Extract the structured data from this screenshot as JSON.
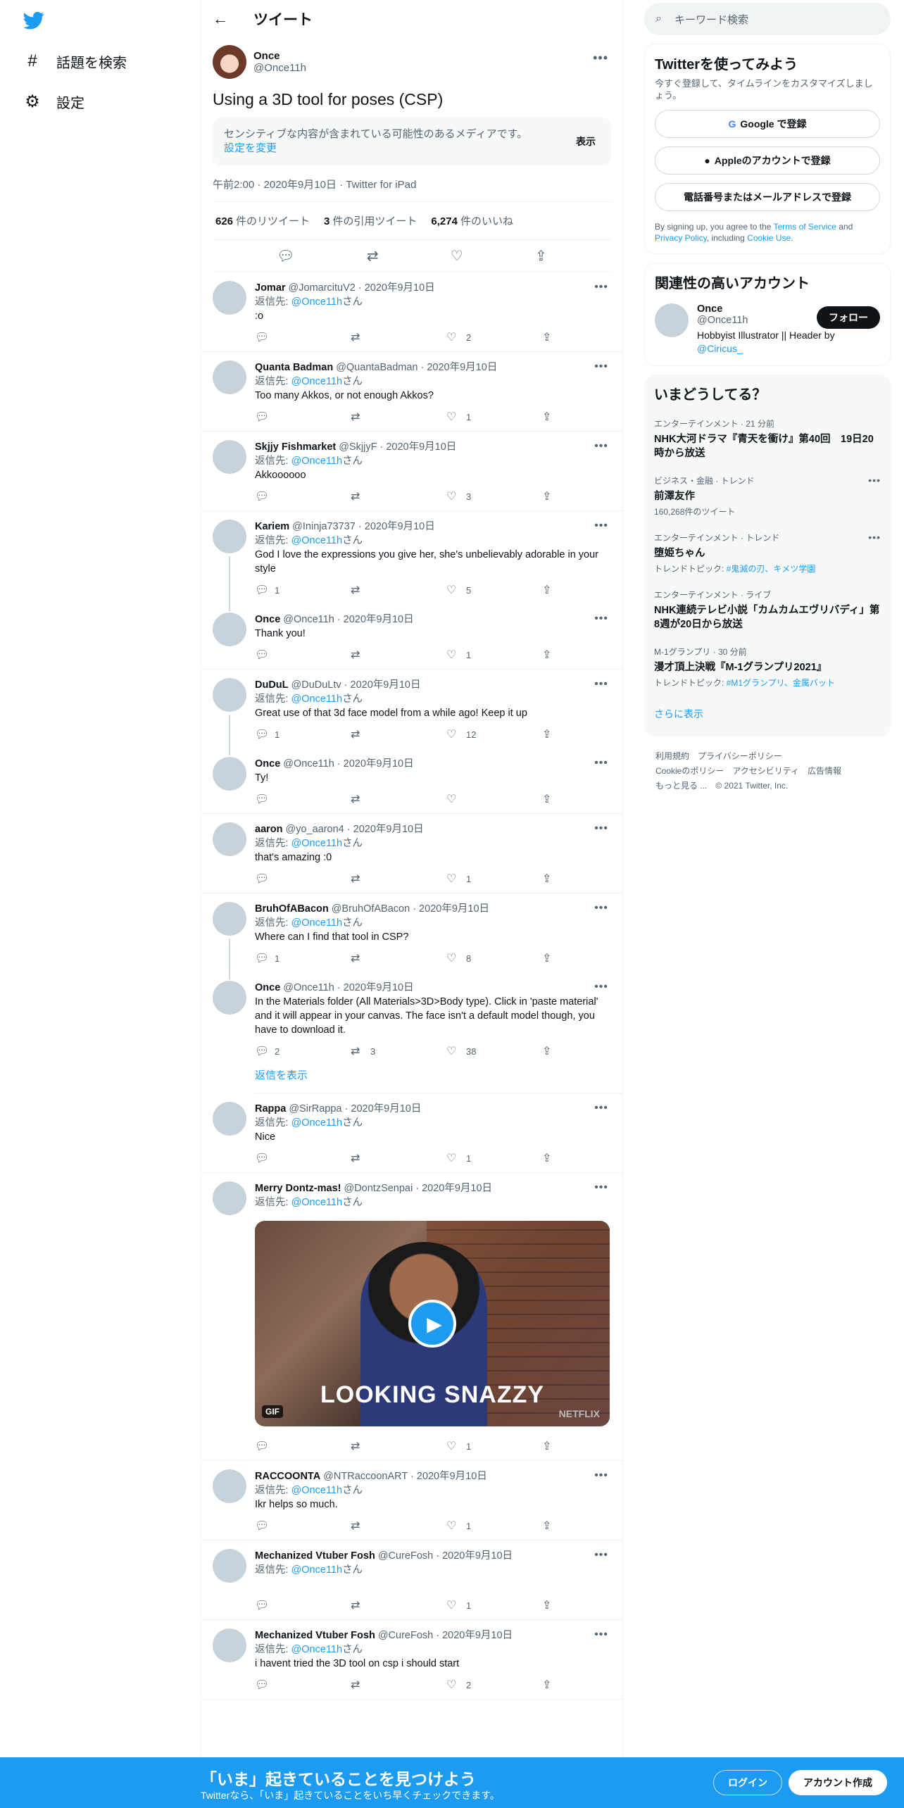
{
  "nav": {
    "explore_label": "話題を検索",
    "settings_label": "設定"
  },
  "header": {
    "title": "ツイート"
  },
  "focal": {
    "name": "Once",
    "handle": "@Once11h",
    "text": "Using a 3D tool for poses (CSP)",
    "sensitive_msg": "センシティブな内容が含まれている可能性のあるメディアです。",
    "sensitive_link": "設定を変更",
    "show_label": "表示",
    "meta": "午前2:00 · 2020年9月10日 · Twitter for iPad",
    "retweets": "626",
    "retweets_label": "件のリツイート",
    "quotes": "3",
    "quotes_label": "件の引用ツイート",
    "likes": "6,274",
    "likes_label": "件のいいね"
  },
  "replies": [
    {
      "name": "Jomar",
      "handle": "@JomarcituV2 · 2020年9月10日",
      "to": "返信先: ",
      "to_link": "@Once11h",
      "to_suffix": "さん",
      "text": ":o",
      "replies": "",
      "rts": "",
      "likes": "2"
    },
    {
      "name": "Quanta Badman",
      "handle": "@QuantaBadman · 2020年9月10日",
      "to": "返信先: ",
      "to_link": "@Once11h",
      "to_suffix": "さん",
      "text": "Too many Akkos, or not enough Akkos?",
      "replies": "",
      "rts": "",
      "likes": "1"
    },
    {
      "name": "Skjjy Fishmarket",
      "handle": "@SkjjyF · 2020年9月10日",
      "to": "返信先: ",
      "to_link": "@Once11h",
      "to_suffix": "さん",
      "text": "Akkoooooo",
      "replies": "",
      "rts": "",
      "likes": "3"
    },
    {
      "name": "Kariem",
      "handle": "@Ininja73737 · 2020年9月10日",
      "to": "返信先: ",
      "to_link": "@Once11h",
      "to_suffix": "さん",
      "text": "God I love the expressions you give her, she's unbelievably  adorable in your style",
      "replies": "1",
      "rts": "",
      "likes": "5"
    },
    {
      "name": "Once",
      "handle": "@Once11h · 2020年9月10日",
      "text": "Thank you!",
      "replies": "",
      "rts": "",
      "likes": "1"
    },
    {
      "name": "DuDuL",
      "handle": "@DuDuLtv · 2020年9月10日",
      "to": "返信先: ",
      "to_link": "@Once11h",
      "to_suffix": "さん",
      "text": "Great use of that 3d face model from a while ago! Keep it up",
      "replies": "1",
      "rts": "",
      "likes": "12"
    },
    {
      "name": "Once",
      "handle": "@Once11h · 2020年9月10日",
      "text": "Ty!",
      "replies": "",
      "rts": "",
      "likes": ""
    },
    {
      "name": "aaron",
      "handle": "@yo_aaron4 · 2020年9月10日",
      "to": "返信先: ",
      "to_link": "@Once11h",
      "to_suffix": "さん",
      "text": "that's amazing :0",
      "replies": "",
      "rts": "",
      "likes": "1"
    },
    {
      "name": "BruhOfABacon",
      "handle": "@BruhOfABacon · 2020年9月10日",
      "to": "返信先: ",
      "to_link": "@Once11h",
      "to_suffix": "さん",
      "text": "Where can I find that tool in CSP?",
      "replies": "1",
      "rts": "",
      "likes": "8"
    },
    {
      "name": "Once",
      "handle": "@Once11h · 2020年9月10日",
      "text": "In the Materials folder (All Materials>3D>Body type). Click in 'paste material' and it will appear in your canvas. The face isn't a default model though, you have to download it.",
      "replies": "2",
      "rts": "3",
      "likes": "38"
    },
    {
      "name": "Rappa",
      "handle": "@SirRappa · 2020年9月10日",
      "to": "返信先: ",
      "to_link": "@Once11h",
      "to_suffix": "さん",
      "text": "Nice",
      "replies": "",
      "rts": "",
      "likes": "1"
    },
    {
      "name": "Merry Dontz-mas!",
      "handle": "@DontzSenpai · 2020年9月10日",
      "to": "返信先: ",
      "to_link": "@Once11h",
      "to_suffix": "さん",
      "text": "",
      "gif_caption": "LOOKING SNAZZY",
      "gif_badge": "GIF",
      "gif_brand": "NETFLIX",
      "replies": "",
      "rts": "",
      "likes": "1"
    },
    {
      "name": "RACCOONTA",
      "handle": "@NTRaccoonART · 2020年9月10日",
      "to": "返信先: ",
      "to_link": "@Once11h",
      "to_suffix": "さん",
      "text": "Ikr helps so much.",
      "replies": "",
      "rts": "",
      "likes": "1"
    },
    {
      "name": "Mechanized Vtuber Fosh",
      "handle": "@CureFosh · 2020年9月10日",
      "to": "返信先: ",
      "to_link": "@Once11h",
      "to_suffix": "さん",
      "text": "",
      "replies": "",
      "rts": "",
      "likes": "1"
    },
    {
      "name": "Mechanized Vtuber Fosh",
      "handle": "@CureFosh · 2020年9月10日",
      "to": "返信先: ",
      "to_link": "@Once11h",
      "to_suffix": "さん",
      "text": "i havent tried the 3D tool on csp i should start",
      "replies": "",
      "rts": "",
      "likes": "2"
    }
  ],
  "show_replies_label": "返信を表示",
  "sidebar": {
    "search_placeholder": "キーワード検索",
    "signup_title": "Twitterを使ってみよう",
    "signup_sub": "今すぐ登録して、タイムラインをカスタマイズしましょう。",
    "google_btn": "Google で登録",
    "apple_btn": "Appleのアカウントで登録",
    "phone_btn": "電話番号またはメールアドレスで登録",
    "terms_pre": "By signing up, you agree to the ",
    "terms_tos": "Terms of Service",
    "terms_and": " and ",
    "terms_privacy": "Privacy Policy",
    "terms_incl": ", including ",
    "terms_cookie": "Cookie Use",
    "terms_end": ".",
    "related_title": "関連性の高いアカウント",
    "acc_name": "Once",
    "acc_handle": "@Once11h",
    "follow_label": "フォロー",
    "acc_bio": "Hobbyist Illustrator || Header by ",
    "acc_bio_link": "@Ciricus_",
    "trends_title": "いまどうしてる？",
    "trends": [
      {
        "cat": "エンターテインメント · 21 分前",
        "ttl": "NHK大河ドラマ『青天を衝け』第40回　19日20時から放送",
        "sub": ""
      },
      {
        "cat": "ビジネス・金融 · トレンド",
        "ttl": "前澤友作",
        "sub": "160,268件のツイート"
      },
      {
        "cat": "エンターテインメント · トレンド",
        "ttl": "堕姫ちゃん",
        "sub": "トレンドトピック: ",
        "sub_link": "#鬼滅の刃、キメツ学園"
      },
      {
        "cat": "エンターテインメント · ライブ",
        "ttl": "NHK連続テレビ小説「カムカムエヴリバディ」第8週が20日から放送",
        "sub": ""
      },
      {
        "cat": "M-1グランプリ · 30 分前",
        "ttl": "漫才頂上決戦『M-1グランプリ2021』",
        "sub": "トレンドトピック: ",
        "sub_link": "#M1グランプリ、金属バット"
      }
    ],
    "show_more": "さらに表示",
    "footer": [
      "利用規約",
      "プライバシーポリシー",
      "Cookieのポリシー",
      "アクセシビリティ",
      "広告情報",
      "もっと見る ...",
      "© 2021 Twitter, Inc."
    ]
  },
  "bottombar": {
    "title": "「いま」起きていることを見つけよう",
    "sub": "Twitterなら、「いま」起きていることをいち早くチェックできます。",
    "login": "ログイン",
    "signup": "アカウント作成"
  },
  "colors": {
    "accent": "#1d9bf0",
    "text": "#0f1419",
    "muted": "#536471"
  },
  "icons": [
    "twitter-logo-icon",
    "hashtag-icon",
    "gear-icon",
    "back-arrow-icon",
    "more-icon",
    "reply-icon",
    "retweet-icon",
    "like-icon",
    "share-icon",
    "search-icon",
    "google-icon",
    "apple-icon",
    "play-icon"
  ]
}
